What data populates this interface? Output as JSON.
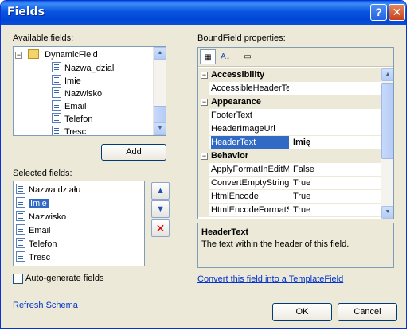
{
  "window": {
    "title": "Fields",
    "help_label": "?",
    "close_label": "✕"
  },
  "available": {
    "label": "Available fields:",
    "root": "DynamicField",
    "items": [
      "Nazwa_dzial",
      "Imie",
      "Nazwisko",
      "Email",
      "Telefon",
      "Tresc"
    ]
  },
  "add_button": "Add",
  "selected": {
    "label": "Selected fields:",
    "items": [
      "Nazwa działu",
      "Imie",
      "Nazwisko",
      "Email",
      "Telefon",
      "Tresc"
    ],
    "selected_item": "Imie"
  },
  "autogen": {
    "label": "Auto-generate fields",
    "checked": false
  },
  "refresh_link": "Refresh Schema",
  "properties": {
    "label": "BoundField properties:",
    "toolbar": {
      "categorized": "categorized-icon",
      "alphabetical": "alphabetical-icon",
      "pages": "property-pages-icon"
    },
    "categories": [
      {
        "name": "Accessibility",
        "rows": [
          {
            "name": "AccessibleHeaderText",
            "value": ""
          }
        ]
      },
      {
        "name": "Appearance",
        "rows": [
          {
            "name": "FooterText",
            "value": ""
          },
          {
            "name": "HeaderImageUrl",
            "value": ""
          },
          {
            "name": "HeaderText",
            "value": "Imię"
          }
        ]
      },
      {
        "name": "Behavior",
        "rows": [
          {
            "name": "ApplyFormatInEditMode",
            "value": "False"
          },
          {
            "name": "ConvertEmptyStringToNull",
            "value": "True"
          },
          {
            "name": "HtmlEncode",
            "value": "True"
          },
          {
            "name": "HtmlEncodeFormatString",
            "value": "True"
          }
        ]
      }
    ],
    "selected_property": "HeaderText",
    "expander": "−"
  },
  "description": {
    "title": "HeaderText",
    "text": "The text within the header of this field."
  },
  "convert_link": "Convert this field into a TemplateField",
  "buttons": {
    "ok": "OK",
    "cancel": "Cancel"
  },
  "colors": {
    "selection": "#316ac5",
    "title_bar": "#0a55e0",
    "dialog_bg": "#ece9d8",
    "link": "#0033cc"
  }
}
